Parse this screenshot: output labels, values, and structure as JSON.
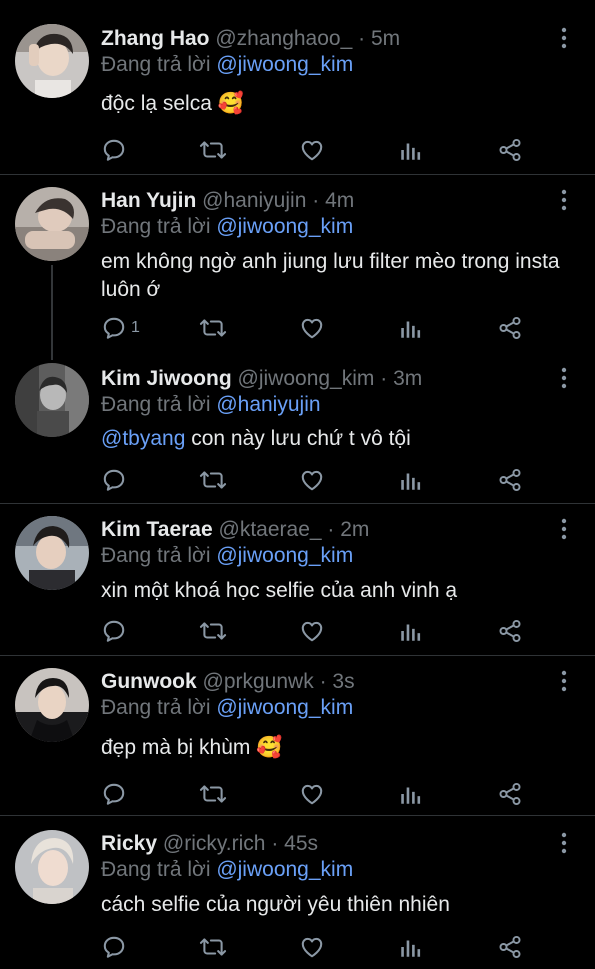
{
  "reply_prefix": "Đang trả lời",
  "tweets": [
    {
      "name": "Zhang Hao",
      "handle": "@zhanghaoo_",
      "time": "5m",
      "reply_to": "@jiwoong_kim",
      "text_mention": "",
      "text": "độc lạ selca 🥰",
      "reply_count": ""
    },
    {
      "name": "Han Yujin",
      "handle": "@haniyujin",
      "time": "4m",
      "reply_to": "@jiwoong_kim",
      "text_mention": "",
      "text": "em không ngờ anh jiung lưu filter mèo trong insta luôn ớ",
      "reply_count": "1"
    },
    {
      "name": "Kim Jiwoong",
      "handle": "@jiwoong_kim",
      "time": "3m",
      "reply_to": "@haniyujin",
      "text_mention": "@tbyang",
      "text": " con này lưu chứ t vô tội",
      "reply_count": ""
    },
    {
      "name": "Kim Taerae",
      "handle": "@ktaerae_",
      "time": "2m",
      "reply_to": "@jiwoong_kim",
      "text_mention": "",
      "text": "xin một khoá học selfie của anh vinh ạ",
      "reply_count": ""
    },
    {
      "name": "Gunwook",
      "handle": "@prkgunwk",
      "time": "3s",
      "reply_to": "@jiwoong_kim",
      "text_mention": "",
      "text": "đẹp mà bị khùm 🥰",
      "reply_count": ""
    },
    {
      "name": "Ricky",
      "handle": "@ricky.rich",
      "time": "45s",
      "reply_to": "@jiwoong_kim",
      "text_mention": "",
      "text": "cách selfie của người yêu thiên nhiên",
      "reply_count": ""
    }
  ],
  "separator_dot": "·",
  "icons": {
    "reply": "reply-icon",
    "retweet": "retweet-icon",
    "like": "like-icon",
    "views": "views-icon",
    "share": "share-icon",
    "more": "more-options-icon"
  },
  "colors": {
    "background": "#000000",
    "primary_text": "#e7e9ea",
    "secondary_text": "#71767b",
    "mention": "#6aa0f7",
    "divider": "#2f3336",
    "icon": "#8b98a5"
  }
}
